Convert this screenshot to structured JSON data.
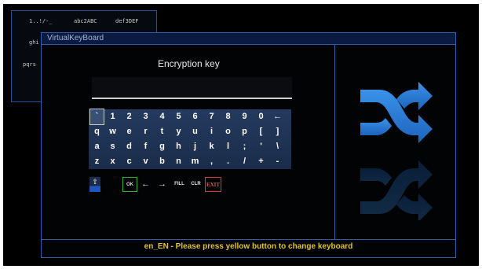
{
  "background_window": {
    "keys": [
      "1..!/-_",
      "abc2ABC",
      "def3DEF",
      "ghi",
      "pqrs"
    ]
  },
  "window": {
    "title": "VirtualKeyBoard",
    "heading": "Encryption key",
    "input_value": ""
  },
  "keyboard": {
    "rows": [
      [
        "`",
        "1",
        "2",
        "3",
        "4",
        "5",
        "6",
        "7",
        "8",
        "9",
        "0",
        "←"
      ],
      [
        "q",
        "w",
        "e",
        "r",
        "t",
        "y",
        "u",
        "i",
        "o",
        "p",
        "[",
        "]"
      ],
      [
        "a",
        "s",
        "d",
        "f",
        "g",
        "h",
        "j",
        "k",
        "l",
        ";",
        "'",
        "\\"
      ],
      [
        "z",
        "x",
        "c",
        "v",
        "b",
        "n",
        "m",
        ",",
        ".",
        "/",
        "+",
        "-"
      ]
    ],
    "selected_key": "`",
    "controls": {
      "shift": "⇧",
      "ok": "OK",
      "left": "←",
      "right": "→",
      "fill": "FILL",
      "clr": "CLR",
      "exit": "EXIT"
    }
  },
  "status": "en_EN - Please press yellow button to change keyboard",
  "icon": "shuffle-icon",
  "colors": {
    "border": "#2f5ab0",
    "status_text": "#e0c238",
    "ok_border": "#2fae3a",
    "exit_border": "#d23a3a",
    "icon": "#2f7fd6"
  }
}
